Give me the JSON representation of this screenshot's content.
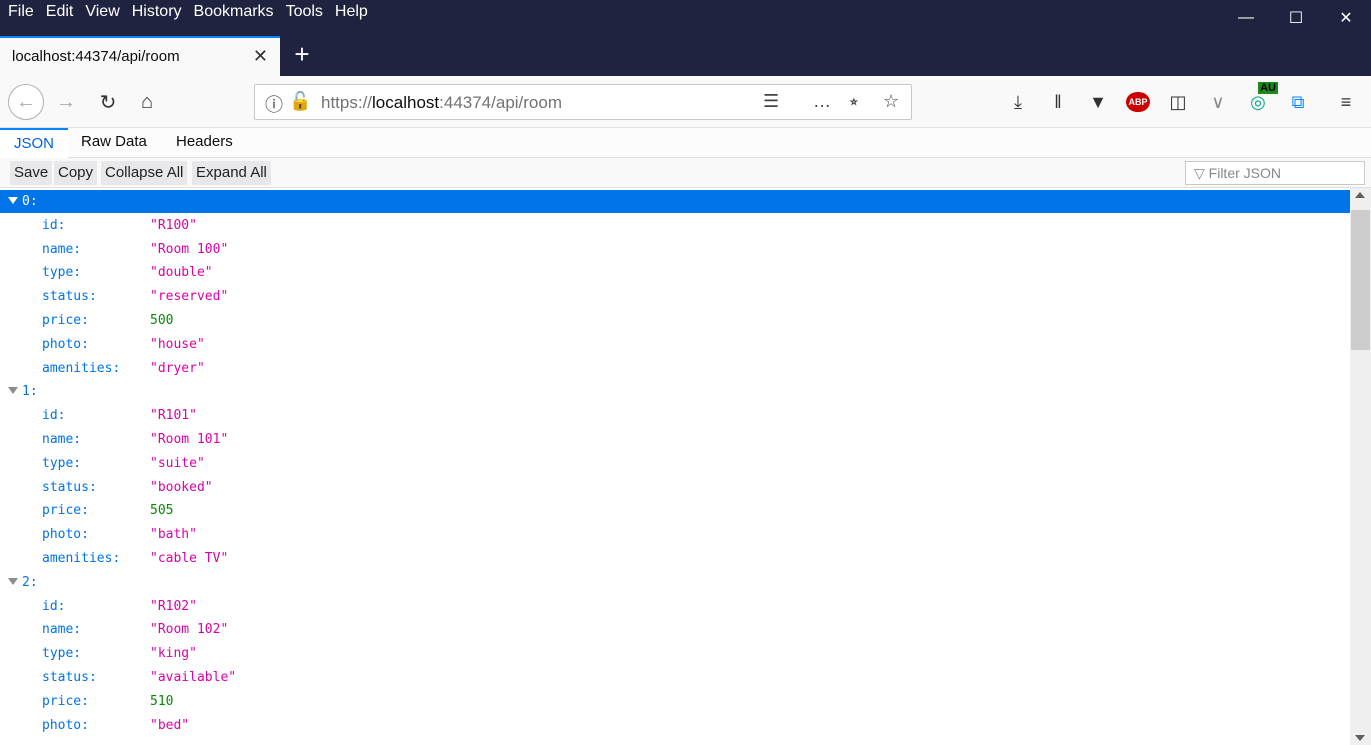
{
  "menu": {
    "items": [
      "File",
      "Edit",
      "View",
      "History",
      "Bookmarks",
      "Tools",
      "Help"
    ]
  },
  "tab": {
    "title": "localhost:44374/api/room"
  },
  "url": {
    "scheme": "https://",
    "host": "localhost",
    "rest": ":44374/api/room"
  },
  "viewer_tabs": {
    "json": "JSON",
    "raw": "Raw Data",
    "headers": "Headers"
  },
  "toolbar": {
    "save": "Save",
    "copy": "Copy",
    "collapse": "Collapse All",
    "expand": "Expand All",
    "filter_placeholder": "Filter JSON"
  },
  "extensions": {
    "au_badge": "AU",
    "abp": "ABP"
  },
  "rooms": [
    {
      "index": "0:",
      "fields": [
        {
          "key": "id:",
          "value": "\"R100\"",
          "kind": "str"
        },
        {
          "key": "name:",
          "value": "\"Room 100\"",
          "kind": "str"
        },
        {
          "key": "type:",
          "value": "\"double\"",
          "kind": "str"
        },
        {
          "key": "status:",
          "value": "\"reserved\"",
          "kind": "str"
        },
        {
          "key": "price:",
          "value": "500",
          "kind": "num"
        },
        {
          "key": "photo:",
          "value": "\"house\"",
          "kind": "str"
        },
        {
          "key": "amenities:",
          "value": "\"dryer\"",
          "kind": "str"
        }
      ]
    },
    {
      "index": "1:",
      "fields": [
        {
          "key": "id:",
          "value": "\"R101\"",
          "kind": "str"
        },
        {
          "key": "name:",
          "value": "\"Room 101\"",
          "kind": "str"
        },
        {
          "key": "type:",
          "value": "\"suite\"",
          "kind": "str"
        },
        {
          "key": "status:",
          "value": "\"booked\"",
          "kind": "str"
        },
        {
          "key": "price:",
          "value": "505",
          "kind": "num"
        },
        {
          "key": "photo:",
          "value": "\"bath\"",
          "kind": "str"
        },
        {
          "key": "amenities:",
          "value": "\"cable TV\"",
          "kind": "str"
        }
      ]
    },
    {
      "index": "2:",
      "fields": [
        {
          "key": "id:",
          "value": "\"R102\"",
          "kind": "str"
        },
        {
          "key": "name:",
          "value": "\"Room 102\"",
          "kind": "str"
        },
        {
          "key": "type:",
          "value": "\"king\"",
          "kind": "str"
        },
        {
          "key": "status:",
          "value": "\"available\"",
          "kind": "str"
        },
        {
          "key": "price:",
          "value": "510",
          "kind": "num"
        },
        {
          "key": "photo:",
          "value": "\"bed\"",
          "kind": "str"
        }
      ]
    }
  ]
}
